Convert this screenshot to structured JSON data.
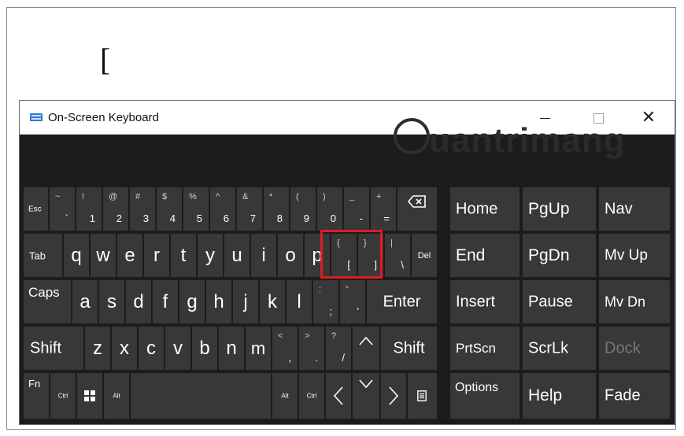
{
  "document": {
    "typed_text": "["
  },
  "window": {
    "title": "On-Screen Keyboard",
    "minimize_label": "—",
    "close_label": "✕",
    "watermark": "uantrimang",
    "accent_color": "#2f7bd6",
    "highlight_color": "#e01b24"
  },
  "rows": {
    "row1": {
      "esc": "Esc",
      "k1": {
        "sub": "!",
        "main": "1"
      },
      "k2": {
        "sub": "@",
        "main": "2"
      },
      "k3": {
        "sub": "#",
        "main": "3"
      },
      "k4": {
        "sub": "$",
        "main": "4"
      },
      "k5": {
        "sub": "%",
        "main": "5"
      },
      "k6": {
        "sub": "^",
        "main": "6"
      },
      "k7": {
        "sub": "&",
        "main": "7"
      },
      "k8": {
        "sub": "*",
        "main": "8"
      },
      "k9": {
        "sub": "(",
        "main": "9"
      },
      "k0": {
        "sub": ")",
        "main": "0"
      },
      "kminus": {
        "sub": "_",
        "main": "-"
      },
      "kplus": {
        "sub": "+",
        "main": "="
      },
      "tilde": {
        "sub": "~",
        "main": "`"
      }
    },
    "row2": {
      "tab": "Tab",
      "letters": [
        "q",
        "w",
        "e",
        "r",
        "t",
        "y",
        "u",
        "i",
        "o",
        "p"
      ],
      "lbrace": {
        "sub": "{",
        "main": "["
      },
      "rbrace": {
        "sub": "}",
        "main": "]"
      },
      "pipe": {
        "sub": "|",
        "main": "\\"
      },
      "del": "Del"
    },
    "row3": {
      "caps": "Caps",
      "letters": [
        "a",
        "s",
        "d",
        "f",
        "g",
        "h",
        "j",
        "k",
        "l"
      ],
      "semi": {
        "sub": ":",
        "main": ";"
      },
      "quote": {
        "sub": "\"",
        "main": "'"
      },
      "enter": "Enter"
    },
    "row4": {
      "shift_left": "Shift",
      "letters": [
        "z",
        "x",
        "c",
        "v",
        "b",
        "n",
        "m"
      ],
      "comma": {
        "sub": "<",
        "main": ","
      },
      "period": {
        "sub": ">",
        "main": "."
      },
      "slash": {
        "sub": "?",
        "main": "/"
      },
      "up": "^",
      "shift_right": "Shift"
    },
    "row5": {
      "fn": "Fn",
      "ctrl": "Ctrl",
      "alt": "Alt",
      "alt_right": "Alt",
      "ctrl_right": "Ctrl",
      "left": "<",
      "down": "v",
      "right": ">"
    }
  },
  "nav_keys": {
    "home": "Home",
    "pgup": "PgUp",
    "nav": "Nav",
    "end": "End",
    "pgdn": "PgDn",
    "mvup": "Mv Up",
    "insert": "Insert",
    "pause": "Pause",
    "mvdn": "Mv Dn",
    "prtscn": "PrtScn",
    "scrlk": "ScrLk",
    "dock": "Dock",
    "options": "Options",
    "help": "Help",
    "fade": "Fade"
  }
}
